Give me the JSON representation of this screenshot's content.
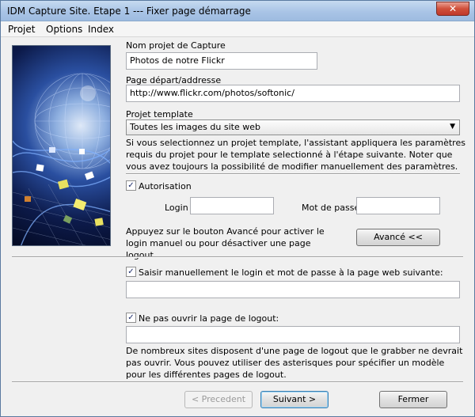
{
  "window": {
    "title": "IDM Capture Site. Etape 1 --- Fixer page démarrage",
    "close_glyph": "✕"
  },
  "menu": [
    "Projet",
    "Options",
    "Index"
  ],
  "project_name": {
    "label": "Nom projet de Capture",
    "value": "Photos de notre Flickr"
  },
  "start_page": {
    "label": "Page départ/addresse",
    "value": "http://www.flickr.com/photos/softonic/"
  },
  "template": {
    "label": "Projet template",
    "selected": "Toutes les images du site web",
    "description": "Si vous selectionnez un projet template, l'assistant appliquera les paramètres requis du projet pour le template selectionné à l'étape suivante. Noter que vous avez toujours la possibilité de modifier manuellement des paramètres."
  },
  "authorization": {
    "label": "Autorisation",
    "checked": true,
    "login_label": "Login",
    "login_value": "",
    "password_label": "Mot de passe",
    "password_value": "",
    "advanced_hint": "Appuyez sur le bouton Avancé pour activer le login manuel ou pour désactiver une page logout",
    "advanced_button": "Avancé <<"
  },
  "manual_login": {
    "label": "Saisir manuellement le login et mot de passe à la page web suivante:",
    "checked": true,
    "value": ""
  },
  "logout": {
    "label": "Ne pas ouvrir la page de logout:",
    "checked": true,
    "value": "",
    "description": "De nombreux sites disposent d'une page de logout que le grabber ne devrait pas ouvrir. Vous pouvez utiliser des asterisques pour spécifier un modèle pour les différentes pages de logout."
  },
  "footer": {
    "prev": "< Precedent",
    "next": "Suivant >",
    "close": "Fermer"
  },
  "check_glyph": "✓"
}
